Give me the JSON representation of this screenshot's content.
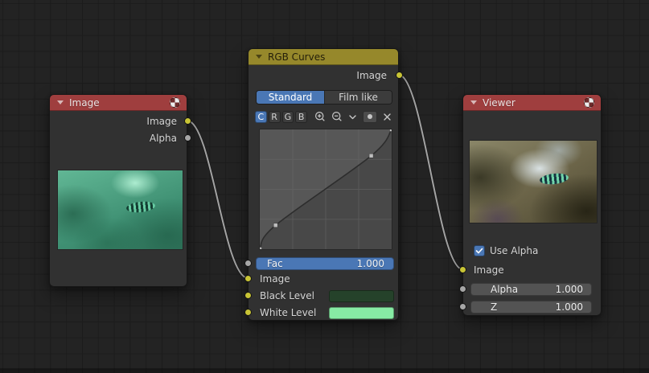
{
  "colors": {
    "accent_blue": "#4a77b5",
    "header_red": "#9f3e3e",
    "header_olive": "#96882b",
    "socket_yellow": "#c8c435",
    "socket_gray": "#a6a6a6",
    "black_level_swatch": "#25422a",
    "white_level_swatch": "#87eba4"
  },
  "image_node": {
    "title": "Image",
    "outputs": [
      {
        "label": "Image",
        "socket": "yellow"
      },
      {
        "label": "Alpha",
        "socket": "gray"
      }
    ],
    "preview": "underwater-green-photo"
  },
  "curves_node": {
    "title": "RGB Curves",
    "output_label": "Image",
    "tabs": [
      {
        "label": "Standard",
        "selected": true
      },
      {
        "label": "Film like",
        "selected": false
      }
    ],
    "channels": [
      {
        "label": "C",
        "selected": true
      },
      {
        "label": "R",
        "selected": false
      },
      {
        "label": "G",
        "selected": false
      },
      {
        "label": "B",
        "selected": false
      }
    ],
    "toolbar_icons": [
      "zoom-in",
      "zoom-out",
      "chevron-down",
      "clipping-dot",
      "remove-x"
    ],
    "curve_points": [
      [
        0,
        0
      ],
      [
        0.12,
        0.2
      ],
      [
        0.845,
        0.78
      ],
      [
        1,
        1
      ]
    ],
    "fac": {
      "label": "Fac",
      "value": "1.000"
    },
    "inputs": [
      {
        "label": "Image",
        "socket": "yellow"
      },
      {
        "label": "Black Level",
        "socket": "yellow"
      },
      {
        "label": "White Level",
        "socket": "yellow"
      }
    ]
  },
  "viewer_node": {
    "title": "Viewer",
    "use_alpha": {
      "label": "Use Alpha",
      "checked": true
    },
    "inputs": [
      {
        "label": "Image",
        "socket": "yellow"
      }
    ],
    "fields": [
      {
        "label": "Alpha",
        "value": "1.000"
      },
      {
        "label": "Z",
        "value": "1.000"
      }
    ],
    "preview": "underwater-corrected-photo"
  }
}
